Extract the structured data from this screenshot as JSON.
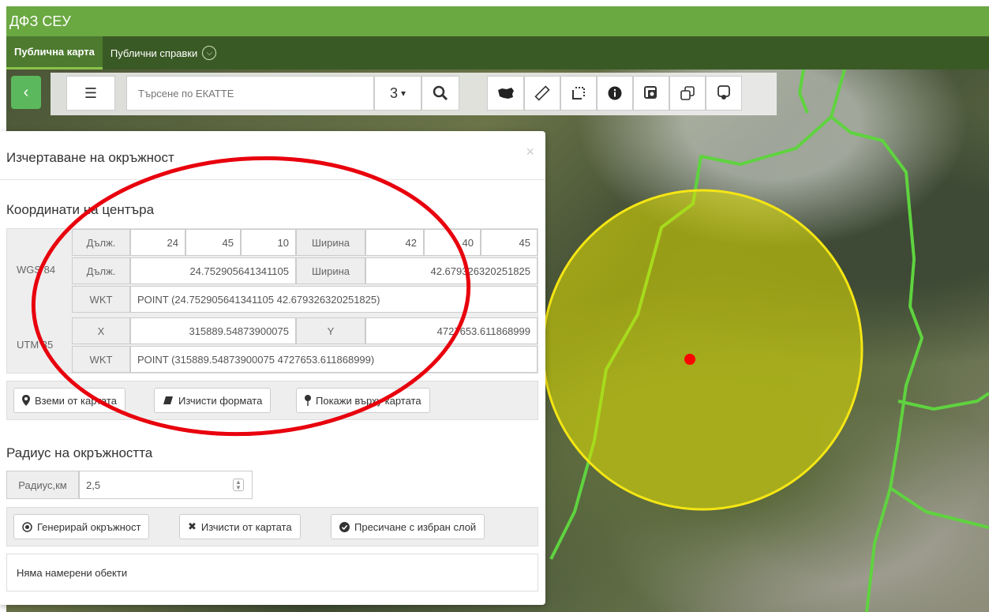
{
  "app": {
    "title": "ДФЗ СЕУ"
  },
  "nav": {
    "tabs": [
      {
        "label": "Публична карта"
      },
      {
        "label": "Публични справки"
      }
    ]
  },
  "toolbar": {
    "search_placeholder": "Търсене по ЕКАТТЕ",
    "zoom_label": "3",
    "tools": [
      "bulgaria-map-icon",
      "ruler-icon",
      "crop-icon",
      "info-icon",
      "layers-icon",
      "copy-icon",
      "pin-icon"
    ]
  },
  "dialog": {
    "title": "Изчертаване на окръжност",
    "close": "×",
    "center_heading": "Координати на центъра",
    "wgs84": {
      "label": "WGS 84",
      "dms_lon_label": "Дълж.",
      "dms_lon": [
        "24",
        "45",
        "10"
      ],
      "dms_lat_label": "Ширина",
      "dms_lat": [
        "42",
        "40",
        "45"
      ],
      "dec_lon_label": "Дълж.",
      "dec_lon": "24.752905641341105",
      "dec_lat_label": "Ширина",
      "dec_lat": "42.679326320251825",
      "wkt_label": "WKT",
      "wkt": "POINT (24.752905641341105 42.679326320251825)"
    },
    "utm35": {
      "label": "UTM 35",
      "x_label": "X",
      "x": "315889.54873900075",
      "y_label": "Y",
      "y": "4727653.611868999",
      "wkt_label": "WKT",
      "wkt": "POINT (315889.54873900075 4727653.611868999)"
    },
    "center_buttons": {
      "take_from_map": "Вземи от картата",
      "clear_form": "Изчисти формата",
      "show_on_map": "Покажи върху картата"
    },
    "radius_heading": "Радиус на окръжността",
    "radius_label": "Радиус,км",
    "radius_value": "2,5",
    "radius_buttons": {
      "generate": "Генерирай окръжност",
      "clear_map": "Изчисти от картата",
      "intersect": "Пресичане с избран слой"
    },
    "result_text": "Няма намерени обекти"
  },
  "colors": {
    "app_bar": "#6aa842",
    "nav_bar": "#3a5a25",
    "circle_fill": "#e2e200",
    "circle_stroke": "#f5e614",
    "center_point": "#ff0000",
    "annotation_ellipse": "#e8000d",
    "boundary_lines": "#5fd33f"
  }
}
